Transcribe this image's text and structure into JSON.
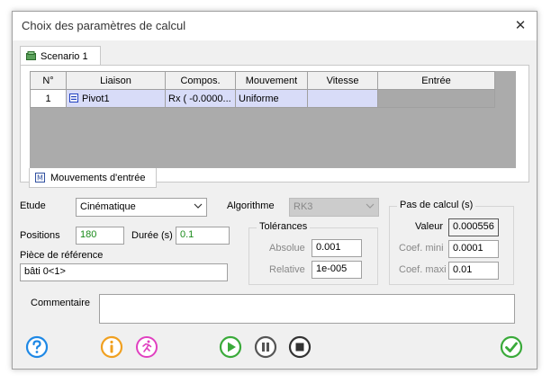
{
  "window": {
    "title": "Choix des paramètres de calcul",
    "close_glyph": "✕"
  },
  "tabs": {
    "scenario": "Scenario 1",
    "mouvements": "Mouvements d'entrée"
  },
  "grid": {
    "columns": [
      "N°",
      "Liaison",
      "Compos.",
      "Mouvement",
      "Vitesse",
      "Entrée"
    ],
    "rows": [
      {
        "num": "1",
        "liaison": "Pivot1",
        "compos": "Rx ( -0.0000...",
        "mouvement": "Uniforme",
        "vitesse": "",
        "entree": ""
      }
    ]
  },
  "etude": {
    "label": "Etude",
    "value": "Cinématique"
  },
  "algorithme": {
    "label": "Algorithme",
    "value": "RK3"
  },
  "positions": {
    "label": "Positions",
    "value": "180"
  },
  "duree": {
    "label": "Durée (s)",
    "value": "0.1"
  },
  "piece": {
    "label": "Pièce de référence",
    "value": "bâti 0<1>"
  },
  "tolerances": {
    "title": "Tolérances",
    "absolue_label": "Absolue",
    "absolue_value": "0.001",
    "relative_label": "Relative",
    "relative_value": "1e-005"
  },
  "pas": {
    "title": "Pas de calcul (s)",
    "valeur_label": "Valeur",
    "valeur_value": "0.000556",
    "mini_label": "Coef. mini",
    "mini_value": "0.0001",
    "maxi_label": "Coef. maxi",
    "maxi_value": "0.01"
  },
  "commentaire": {
    "label": "Commentaire",
    "value": ""
  },
  "toolbar": {
    "help_icon": "question-circle",
    "info_icon": "info-circle",
    "runner_icon": "runner",
    "play_icon": "play",
    "pause_icon": "pause",
    "stop_icon": "stop",
    "ok_icon": "check-circle"
  },
  "colors": {
    "help_blue": "#1e88e5",
    "info_orange": "#f0a020",
    "runner_magenta": "#e040c0",
    "media_green": "#3aaa3a",
    "media_gray": "#555555",
    "ok_green": "#3aaa3a",
    "selection": "#d8dcf8"
  }
}
